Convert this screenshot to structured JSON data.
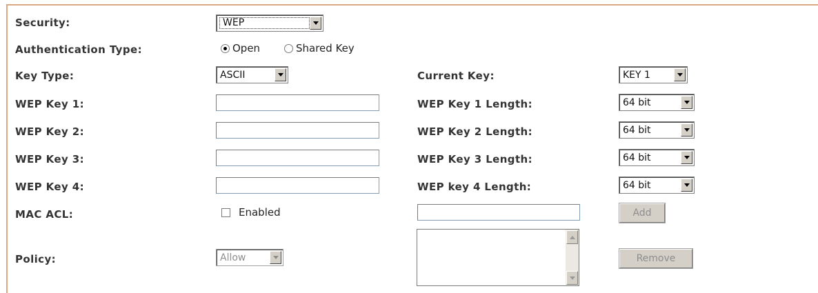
{
  "security": {
    "label": "Security:",
    "value": "WEP"
  },
  "auth": {
    "label": "Authentication Type:",
    "open_label": "Open",
    "shared_label": "Shared Key",
    "selected": "Open"
  },
  "key_type": {
    "label": "Key Type:",
    "value": "ASCII"
  },
  "current_key": {
    "label": "Current Key:",
    "value": "KEY 1"
  },
  "wep_keys": [
    {
      "label": "WEP Key 1:",
      "value": "",
      "length_label": "WEP Key 1 Length:",
      "length_value": "64 bit"
    },
    {
      "label": "WEP Key 2:",
      "value": "",
      "length_label": "WEP Key 2 Length:",
      "length_value": "64 bit"
    },
    {
      "label": "WEP Key 3:",
      "value": "",
      "length_label": "WEP Key 3 Length:",
      "length_value": "64 bit"
    },
    {
      "label": "WEP Key 4:",
      "value": "",
      "length_label": "WEP key 4 Length:",
      "length_value": "64 bit"
    }
  ],
  "mac_acl": {
    "label": "MAC ACL:",
    "enabled_label": "Enabled",
    "enabled": false,
    "mac_value": "",
    "add_label": "Add"
  },
  "policy": {
    "label": "Policy:",
    "value": "Allow",
    "remove_label": "Remove"
  },
  "colors": {
    "frame_border": "#d9a882",
    "label_text": "#333333",
    "disabled_text": "#8e8e8e",
    "button_face": "#d4d0c8"
  }
}
